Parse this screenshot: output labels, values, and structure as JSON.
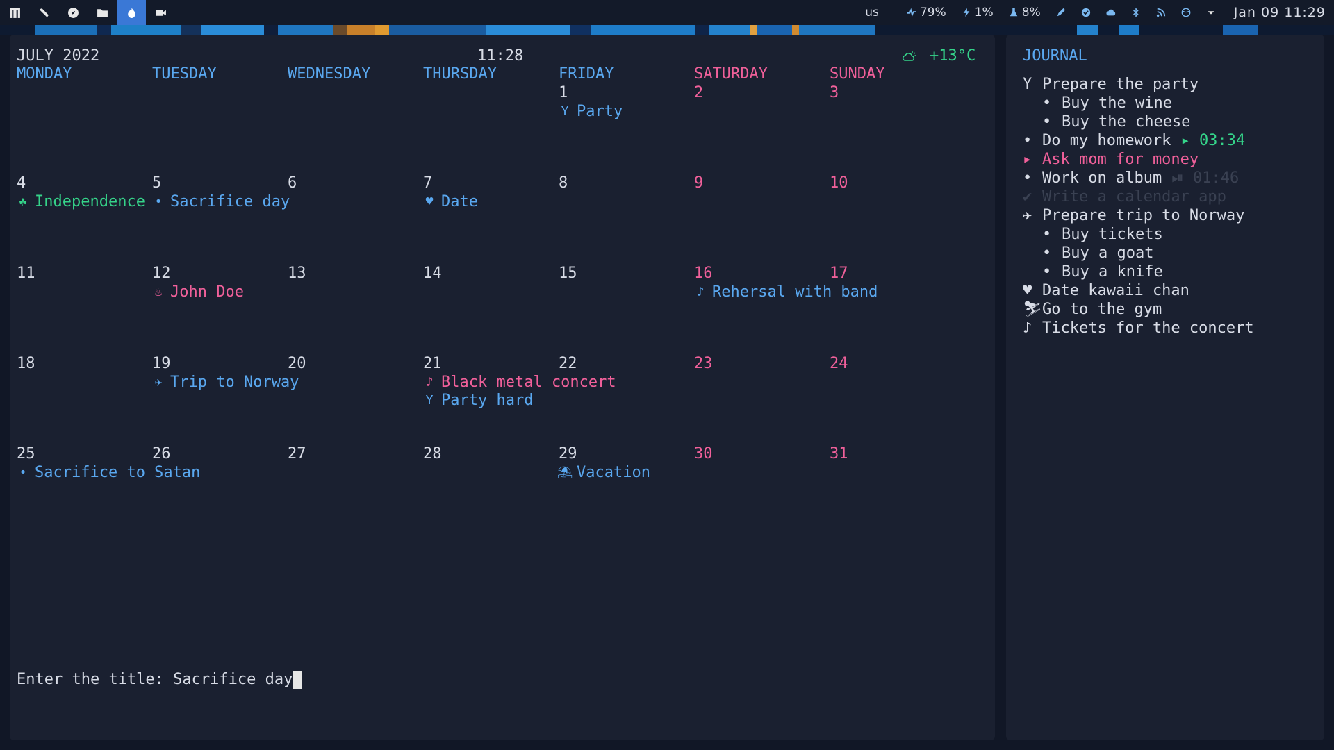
{
  "topbar": {
    "launchers": [
      {
        "icon": "app-menu-icon"
      },
      {
        "icon": "tools-icon"
      },
      {
        "icon": "compass-icon"
      },
      {
        "icon": "folder-icon"
      },
      {
        "icon": "fire-icon",
        "active": true
      },
      {
        "icon": "video-icon"
      }
    ],
    "keyboard_layout": "us",
    "cpu": "79%",
    "power": "1%",
    "memory": "8%",
    "datetime": "Jan 09 11:29",
    "tray_icons": [
      "pen-icon",
      "check-circle-icon",
      "cloud-icon",
      "bluetooth-icon",
      "rss-icon",
      "globe-icon",
      "chevron-down-icon"
    ]
  },
  "calendar": {
    "month_title": "JULY 2022",
    "clock": "11:28",
    "weather": "+13°C",
    "weather_icon": "cloud-sun-icon",
    "weekdays": [
      "MONDAY",
      "TUESDAY",
      "WEDNESDAY",
      "THURSDAY",
      "FRIDAY",
      "SATURDAY",
      "SUNDAY"
    ],
    "weeks": [
      {
        "days": [
          {
            "num": "",
            "events": []
          },
          {
            "num": "",
            "events": []
          },
          {
            "num": "",
            "events": []
          },
          {
            "num": "",
            "events": []
          },
          {
            "num": "1",
            "events": [
              {
                "icon": "cocktail-icon",
                "glyph": "Y",
                "title": "Party",
                "color": "blue"
              }
            ]
          },
          {
            "num": "2",
            "events": []
          },
          {
            "num": "3",
            "events": []
          }
        ]
      },
      {
        "days": [
          {
            "num": "4",
            "events": [
              {
                "icon": "clover-icon",
                "glyph": "☘",
                "title": "Independence",
                "color": "green"
              }
            ]
          },
          {
            "num": "5",
            "events": [
              {
                "icon": "bullet-icon",
                "glyph": "•",
                "title": "Sacrifice day",
                "color": "blue"
              }
            ]
          },
          {
            "num": "6",
            "events": []
          },
          {
            "num": "7",
            "events": [
              {
                "icon": "heart-icon",
                "glyph": "♥",
                "title": "Date",
                "color": "blue"
              }
            ]
          },
          {
            "num": "8",
            "events": []
          },
          {
            "num": "9",
            "events": []
          },
          {
            "num": "10",
            "events": []
          }
        ]
      },
      {
        "days": [
          {
            "num": "11",
            "events": []
          },
          {
            "num": "12",
            "events": [
              {
                "icon": "cake-icon",
                "glyph": "♨",
                "title": "John Doe",
                "color": "pink"
              }
            ]
          },
          {
            "num": "13",
            "events": []
          },
          {
            "num": "14",
            "events": []
          },
          {
            "num": "15",
            "events": []
          },
          {
            "num": "16",
            "events": [
              {
                "icon": "music-note-icon",
                "glyph": "♪",
                "title": "Rehersal with band",
                "color": "blue"
              }
            ]
          },
          {
            "num": "17",
            "events": []
          }
        ]
      },
      {
        "days": [
          {
            "num": "18",
            "events": []
          },
          {
            "num": "19",
            "events": [
              {
                "icon": "airplane-icon",
                "glyph": "✈",
                "title": "Trip to Norway",
                "color": "blue"
              }
            ]
          },
          {
            "num": "20",
            "events": []
          },
          {
            "num": "21",
            "events": [
              {
                "icon": "music-note-icon",
                "glyph": "♪",
                "title": "Black metal concert",
                "color": "pink"
              },
              {
                "icon": "cocktail-icon",
                "glyph": "Y",
                "title": "Party hard",
                "color": "blue"
              }
            ]
          },
          {
            "num": "22",
            "events": []
          },
          {
            "num": "23",
            "events": []
          },
          {
            "num": "24",
            "events": []
          }
        ]
      },
      {
        "days": [
          {
            "num": "25",
            "events": [
              {
                "icon": "bullet-icon",
                "glyph": "•",
                "title": "Sacrifice to Satan",
                "color": "blue"
              }
            ]
          },
          {
            "num": "26",
            "events": []
          },
          {
            "num": "27",
            "events": []
          },
          {
            "num": "28",
            "events": []
          },
          {
            "num": "29",
            "events": [
              {
                "icon": "umbrella-beach-icon",
                "glyph": "⛱",
                "title": "Vacation",
                "color": "blue"
              }
            ]
          },
          {
            "num": "30",
            "events": []
          },
          {
            "num": "31",
            "events": []
          }
        ]
      }
    ],
    "prompt_label": "Enter the title: ",
    "prompt_value": "Sacrifice day"
  },
  "journal": {
    "title": "JOURNAL",
    "items": [
      {
        "icon": "cocktail-icon",
        "glyph": "Y",
        "text": "Prepare the party",
        "level": 0,
        "state": "normal"
      },
      {
        "icon": "bullet-icon",
        "glyph": "•",
        "text": "Buy the wine",
        "level": 1,
        "state": "normal"
      },
      {
        "icon": "bullet-icon",
        "glyph": "•",
        "text": "Buy the cheese",
        "level": 1,
        "state": "normal"
      },
      {
        "icon": "bullet-icon",
        "glyph": "•",
        "text": "Do my homework",
        "level": 0,
        "state": "normal",
        "timer": "03:34",
        "timer_icon": "play-icon",
        "timer_glyph": "▸",
        "timer_state": "running"
      },
      {
        "icon": "play-icon",
        "glyph": "▸",
        "text": "Ask mom for money",
        "level": 0,
        "state": "active"
      },
      {
        "icon": "bullet-icon",
        "glyph": "•",
        "text": "Work on album",
        "level": 0,
        "state": "normal",
        "timer": "01:46",
        "timer_icon": "pause-icon",
        "timer_glyph": "⏯",
        "timer_state": "paused"
      },
      {
        "icon": "check-icon",
        "glyph": "✔",
        "text": "Write a calendar app",
        "level": 0,
        "state": "done"
      },
      {
        "icon": "airplane-icon",
        "glyph": "✈",
        "text": "Prepare trip to Norway",
        "level": 0,
        "state": "normal"
      },
      {
        "icon": "bullet-icon",
        "glyph": "•",
        "text": "Buy tickets",
        "level": 1,
        "state": "normal"
      },
      {
        "icon": "bullet-icon",
        "glyph": "•",
        "text": "Buy a goat",
        "level": 1,
        "state": "normal"
      },
      {
        "icon": "bullet-icon",
        "glyph": "•",
        "text": "Buy a knife",
        "level": 1,
        "state": "normal"
      },
      {
        "icon": "heart-icon",
        "glyph": "♥",
        "text": "Date kawaii chan",
        "level": 0,
        "state": "normal"
      },
      {
        "icon": "runner-icon",
        "glyph": "⛷",
        "text": "Go to the gym",
        "level": 0,
        "state": "normal"
      },
      {
        "icon": "music-note-icon",
        "glyph": "♪",
        "text": "Tickets for the concert",
        "level": 0,
        "state": "normal"
      }
    ]
  },
  "colors": {
    "background": "#111726",
    "panel": "#1a2030",
    "blue": "#5aa8f0",
    "green": "#35d48a",
    "pink": "#f0609a",
    "text": "#d8dce6",
    "faint": "#3a4152",
    "active_launcher": "#3a78d6"
  }
}
